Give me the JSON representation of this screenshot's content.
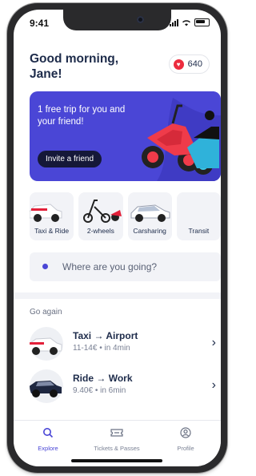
{
  "status_bar": {
    "time": "9:41"
  },
  "header": {
    "greeting": "Good morning,",
    "name": "Jane!",
    "points_badge": "♥",
    "points": "640"
  },
  "promo": {
    "text": "1 free trip for you and your friend!",
    "button": "Invite a friend"
  },
  "modes": [
    {
      "label": "Taxi & Ride",
      "icon": "car-icon"
    },
    {
      "label": "2-wheels",
      "icon": "scooter-icon"
    },
    {
      "label": "Carsharing",
      "icon": "car-icon"
    },
    {
      "label": "Transit",
      "icon": ""
    }
  ],
  "search": {
    "placeholder": "Where are you going?"
  },
  "go_again": {
    "title": "Go again",
    "items": [
      {
        "from": "Taxi",
        "to": "Airport",
        "price": "11-14€",
        "eta": "in 4min"
      },
      {
        "from": "Ride",
        "to": "Work",
        "price": "9.40€",
        "eta": "in 6min"
      }
    ],
    "arrow": "→",
    "sep": "•"
  },
  "tabs": [
    {
      "label": "Explore",
      "icon": "search-icon",
      "active": true
    },
    {
      "label": "Tickets & Passes",
      "icon": "ticket-icon",
      "active": false
    },
    {
      "label": "Profile",
      "icon": "profile-icon",
      "active": false
    }
  ],
  "colors": {
    "accent": "#4a46d6",
    "brand_red": "#ec2c3e",
    "text_dark": "#1d2b4a"
  }
}
